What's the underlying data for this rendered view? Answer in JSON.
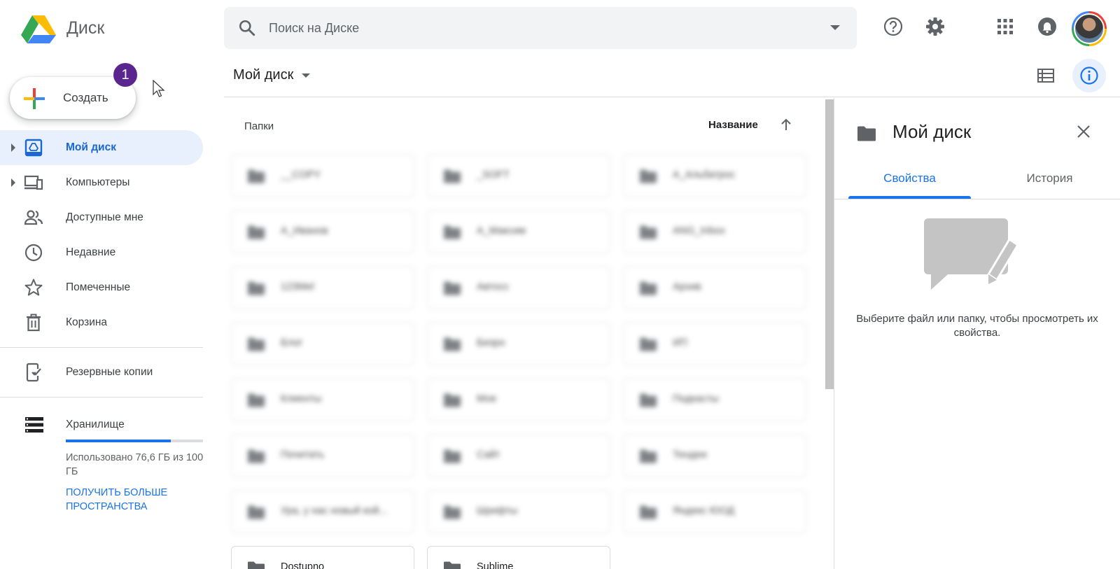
{
  "header": {
    "app_name": "Диск",
    "search_placeholder": "Поиск на Диске"
  },
  "sidebar": {
    "create_label": "Создать",
    "badge": "1",
    "items": [
      {
        "label": "Мой диск",
        "icon": "my-drive-icon",
        "active": true,
        "expandable": true
      },
      {
        "label": "Компьютеры",
        "icon": "computers-icon",
        "active": false,
        "expandable": true
      },
      {
        "label": "Доступные мне",
        "icon": "shared-icon",
        "active": false,
        "expandable": false
      },
      {
        "label": "Недавние",
        "icon": "clock-icon",
        "active": false,
        "expandable": false
      },
      {
        "label": "Помеченные",
        "icon": "star-icon",
        "active": false,
        "expandable": false
      },
      {
        "label": "Корзина",
        "icon": "trash-icon",
        "active": false,
        "expandable": false
      }
    ],
    "backups_label": "Резервные копии",
    "storage": {
      "title": "Хранилище",
      "used_text": "Использовано 76,6 ГБ из 100 ГБ",
      "used_fraction": 0.766,
      "more_link": "Получить больше пространства"
    }
  },
  "main": {
    "title": "Мой диск",
    "section_label": "Папки",
    "sort_label": "Название",
    "folders": [
      {
        "name": "__COPY",
        "blurred": true
      },
      {
        "name": "_SOFT",
        "blurred": true
      },
      {
        "name": "A_Альбатрос",
        "blurred": true
      },
      {
        "name": "A_Иванов",
        "blurred": true
      },
      {
        "name": "A_Максим",
        "blurred": true
      },
      {
        "name": "ANG_Inbox",
        "blurred": true
      },
      {
        "name": "123Mel",
        "blurred": true
      },
      {
        "name": "Автосс",
        "blurred": true
      },
      {
        "name": "Архив",
        "blurred": true
      },
      {
        "name": "Блог",
        "blurred": true
      },
      {
        "name": "Бизро",
        "blurred": true
      },
      {
        "name": "ИП",
        "blurred": true
      },
      {
        "name": "Клиенты",
        "blurred": true
      },
      {
        "name": "Мое",
        "blurred": true
      },
      {
        "name": "Подкасты",
        "blurred": true
      },
      {
        "name": "Почитать",
        "blurred": true
      },
      {
        "name": "Сайт",
        "blurred": true
      },
      {
        "name": "Тендеи",
        "blurred": true
      },
      {
        "name": "Ура, у нас новый кой...",
        "blurred": true
      },
      {
        "name": "Шрифты",
        "blurred": true
      },
      {
        "name": "Яндекс ЮОД",
        "blurred": true
      },
      {
        "name": "Dostupno",
        "blurred": false
      },
      {
        "name": "Sublime",
        "blurred": false
      }
    ]
  },
  "details": {
    "title": "Мой диск",
    "tabs": [
      "Свойства",
      "История"
    ],
    "empty_text": "Выберите файл или папку, чтобы просмотреть их свойства."
  },
  "colors": {
    "accent": "#1a73e8",
    "active_bg": "#e8f0fe",
    "badge": "#5b2590"
  }
}
